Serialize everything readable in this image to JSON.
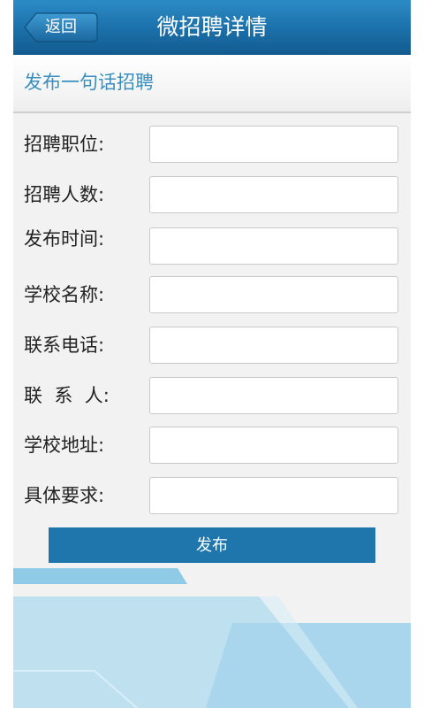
{
  "header": {
    "back_label": "返回",
    "title": "微招聘详情"
  },
  "section": {
    "title": "发布一句话招聘"
  },
  "form": {
    "fields": [
      {
        "label": "招聘职位:",
        "value": ""
      },
      {
        "label": "招聘人数:",
        "value": ""
      },
      {
        "label": "发布时间:",
        "value": ""
      },
      {
        "label": "学校名称:",
        "value": ""
      },
      {
        "label": "联系电话:",
        "value": ""
      },
      {
        "label": "联  系  人:",
        "value": ""
      },
      {
        "label": "学校地址:",
        "value": ""
      },
      {
        "label": "具体要求:",
        "value": ""
      }
    ],
    "submit_label": "发布"
  },
  "colors": {
    "header": "#1b6fa8",
    "accent_text": "#3a8fbf",
    "button": "#1f76ad",
    "background": "#f2f2f2",
    "decor_light": "#bfe0ef",
    "decor_mid": "#8fcbe6"
  },
  "icons": {
    "back": "back-arrow-button-shape"
  }
}
